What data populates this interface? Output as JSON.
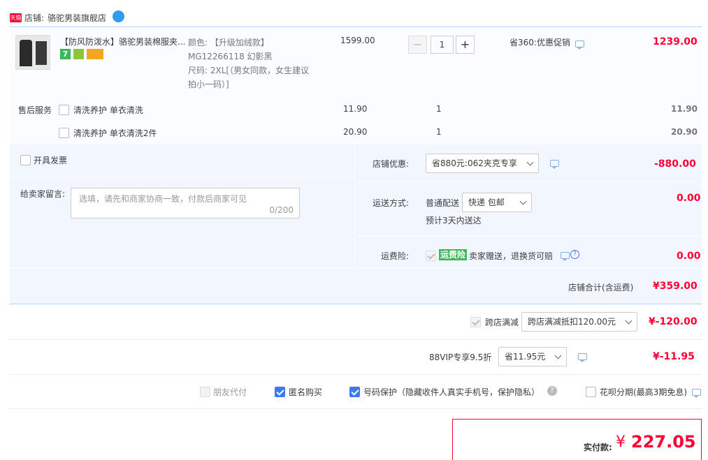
{
  "shop": {
    "badge": "天猫",
    "label": "店铺:",
    "name": "骆驼男装旗舰店"
  },
  "item": {
    "title": "【防风防泼水】骆驼男装棉服夹...",
    "sku_color": "颜色: 【升级加绒款】MG12266118 幻影黑",
    "sku_size": "尺码: 2XL[（男女同款，女生建议拍小一码）]",
    "price": "1599.00",
    "qty": "1",
    "promo": "省360:优惠促销",
    "subtotal": "1239.00",
    "icon_7": "7"
  },
  "after_sale": {
    "label": "售后服务",
    "rows": [
      {
        "name": "清洗养护 单衣清洗",
        "price": "11.90",
        "qty": "1",
        "total": "11.90"
      },
      {
        "name": "清洗养护 单衣清洗2件",
        "price": "20.90",
        "qty": "1",
        "total": "20.90"
      }
    ]
  },
  "invoice": {
    "label": "开具发票"
  },
  "message": {
    "label": "给卖家留言:",
    "placeholder": "选填，请先和商家协商一致，付款后商家可见",
    "count": "0/200"
  },
  "shop_discount": {
    "label": "店铺优惠:",
    "value": "省880元:062夹克专享",
    "amount": "-880.00"
  },
  "shipping": {
    "label": "运送方式:",
    "type": "普通配送",
    "value": "快递 包邮",
    "eta": "预计3天内送达",
    "amount": "0.00"
  },
  "freight_ins": {
    "label": "运费险:",
    "tag": "运费险",
    "desc": "卖家赠送，退换货可赔",
    "amount": "0.00"
  },
  "shop_total": {
    "label": "店铺合计(含运费)",
    "amount": "¥359.00"
  },
  "cross_store": {
    "label": "跨店满减",
    "value": "跨店满减抵扣120.00元",
    "amount": "¥-120.00"
  },
  "vip": {
    "label": "88VIP专享9.5折",
    "value": "省11.95元",
    "amount": "¥-11.95"
  },
  "options": {
    "friend_pay": "朋友代付",
    "anonymous": "匿名购买",
    "number_protect": "号码保护（隐藏收件人真实手机号，保护隐私）",
    "huabei": "花呗分期(最高3期免息)"
  },
  "pay": {
    "label": "实付款:",
    "currency": "¥",
    "amount": "227.05"
  },
  "colors": {
    "red": "#ff0036",
    "blue_bg": "#f2f7ff",
    "border": "#b2d1ff",
    "check_blue": "#3d7af0"
  }
}
